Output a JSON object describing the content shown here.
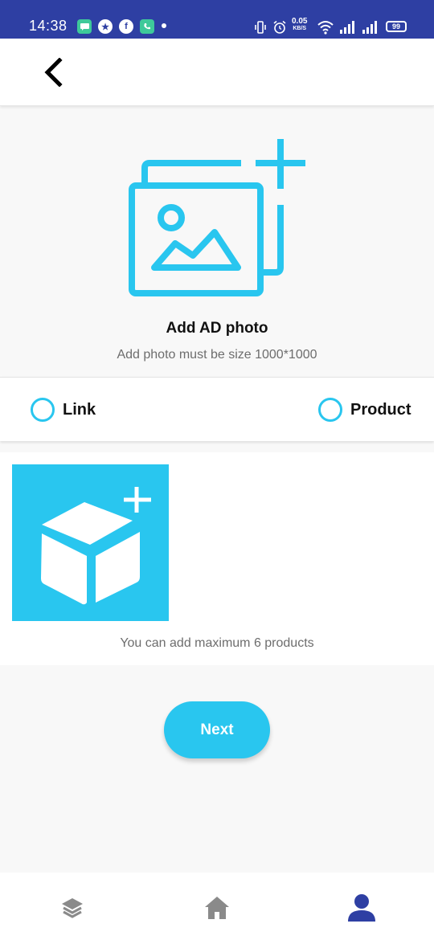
{
  "status_bar": {
    "time": "14:38",
    "net_speed": "0.05",
    "net_unit": "KB/S",
    "battery": "99",
    "background_color": "#2e3fa3"
  },
  "app_bar": {
    "back_icon": "chevron-left-icon"
  },
  "photo_section": {
    "icon": "add-photo-icon",
    "title": "Add AD photo",
    "hint": "Add photo must be size 1000*1000"
  },
  "ad_type": {
    "options": [
      {
        "label": "Link",
        "selected": false
      },
      {
        "label": "Product",
        "selected": false
      }
    ]
  },
  "products": {
    "add_icon": "add-product-box-icon",
    "hint": "You can add maximum 6 products"
  },
  "next_button": {
    "label": "Next"
  },
  "bottom_nav": {
    "items": [
      {
        "icon": "layers-icon",
        "active": false
      },
      {
        "icon": "home-icon",
        "active": false
      },
      {
        "icon": "person-icon",
        "active": true
      }
    ]
  },
  "colors": {
    "accent": "#29c6ef",
    "nav_active": "#2e3fa3",
    "nav_inactive": "#8a8a8a"
  }
}
